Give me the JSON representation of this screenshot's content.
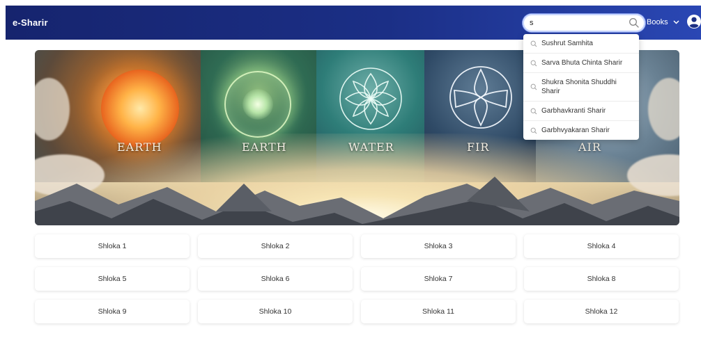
{
  "navbar": {
    "brand": "e-Sharir",
    "search": {
      "value": "s",
      "placeholder": ""
    },
    "books_label": "Books"
  },
  "search_suggestions": [
    "Sushrut Samhita",
    "Sarva Bhuta Chinta Sharir",
    "Shukra Shonita Shuddhi Sharir",
    "Garbhavkranti Sharir",
    "Garbhvyakaran Sharir"
  ],
  "hero": {
    "labels": [
      "EARTH",
      "EARTH",
      "WATER",
      "FIR",
      "AIR"
    ]
  },
  "shlokas": [
    "Shloka 1",
    "Shloka 2",
    "Shloka 3",
    "Shloka 4",
    "Shloka 5",
    "Shloka 6",
    "Shloka 7",
    "Shloka 8",
    "Shloka 9",
    "Shloka 10",
    "Shloka 11",
    "Shloka 12"
  ],
  "colors": {
    "navbar_start": "#16246e",
    "navbar_end": "#2a47b4",
    "card_bg": "#ffffff"
  },
  "icons": [
    "search-icon",
    "chevron-down-icon",
    "user-circle-icon"
  ]
}
